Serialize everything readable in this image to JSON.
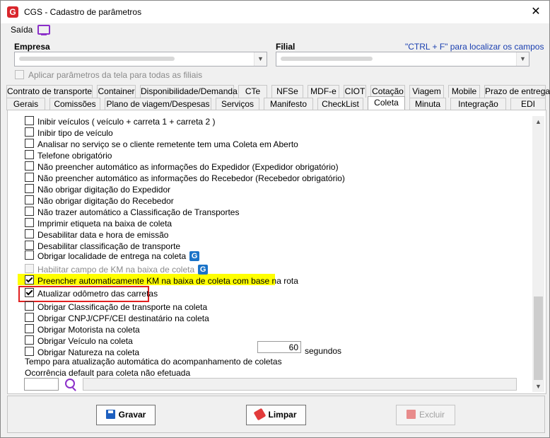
{
  "window": {
    "title": "CGS - Cadastro de parâmetros",
    "close_glyph": "✕"
  },
  "menu": {
    "saida_label": "Saída",
    "icon": "monitor-icon"
  },
  "filters": {
    "empresa_label": "Empresa",
    "filial_label": "Filial",
    "find_hint": "\"CTRL + F\" para localizar os campos",
    "apply_all_label": "Aplicar parâmetros da tela para todas as filiais"
  },
  "tabs_row1": [
    "Contrato de transporte",
    "Container",
    "Disponibilidade/Demanda",
    "CTe",
    "NFSe",
    "MDF-e",
    "CIOT",
    "Cotação",
    "Viagem",
    "Mobile",
    "Prazo de entrega"
  ],
  "tabs_row2": [
    "Gerais",
    "Comissões",
    "Plano de viagem/Despesas",
    "Serviços",
    "Manifesto",
    "CheckList",
    "Coleta",
    "Minuta",
    "Integração",
    "EDI"
  ],
  "active_tab": "Coleta",
  "options": [
    {
      "label": "Inibir veículos ( veículo + carreta 1 + carreta 2 )",
      "checked": false
    },
    {
      "label": "Inibir tipo de veículo",
      "checked": false
    },
    {
      "label": "Analisar no serviço se o cliente remetente tem uma Coleta em Aberto",
      "checked": false
    },
    {
      "label": "Telefone obrigatório",
      "checked": false
    },
    {
      "label": "Não preencher automático as informações do Expedidor (Expedidor obrigatório)",
      "checked": false
    },
    {
      "label": "Não preencher automático as informações do Recebedor (Recebedor obrigatório)",
      "checked": false
    },
    {
      "label": "Não obrigar digitação do Expedidor",
      "checked": false
    },
    {
      "label": "Não obrigar digitação do Recebedor",
      "checked": false
    },
    {
      "label": "Não trazer automático a Classificação de Transportes",
      "checked": false
    },
    {
      "label": "Imprimir etiqueta na baixa de coleta",
      "checked": false
    },
    {
      "label": "Desabilitar data e hora de emissão",
      "checked": false
    },
    {
      "label": "Desabilitar classificação de transporte",
      "checked": false
    },
    {
      "label": "Obrigar localidade de entrega na coleta",
      "checked": false,
      "badge": "G"
    },
    {
      "label": "Habilitar campo de KM na baixa de coleta",
      "checked": false,
      "disabled": true,
      "badge": "G"
    },
    {
      "label": "Preencher automaticamente KM na baixa de coleta com base na rota",
      "checked": true
    },
    {
      "label": "Atualizar odômetro das carretas",
      "checked": true
    },
    {
      "label": "Obrigar Classificação de transporte na coleta",
      "checked": false
    },
    {
      "label": "Obrigar CNPJ/CPF/CEI destinatário na coleta",
      "checked": false
    },
    {
      "label": "Obrigar Motorista na coleta",
      "checked": false
    },
    {
      "label": "Obrigar Veículo na coleta",
      "checked": false
    },
    {
      "label": "Obrigar Natureza na coleta",
      "checked": false
    }
  ],
  "refresh_time": {
    "label": "Tempo para atualização automática do acompanhamento de coletas",
    "value": "60",
    "unit": "segundos"
  },
  "default_occurrence": {
    "label": "Ocorrência default para coleta não efetuada"
  },
  "buttons": {
    "save": "Gravar",
    "clear": "Limpar",
    "delete": "Excluir"
  },
  "colors": {
    "highlight": "#ffff00",
    "red_box": "#e02020",
    "accent": "#8b2fc9",
    "badge": "#1a73c8"
  }
}
